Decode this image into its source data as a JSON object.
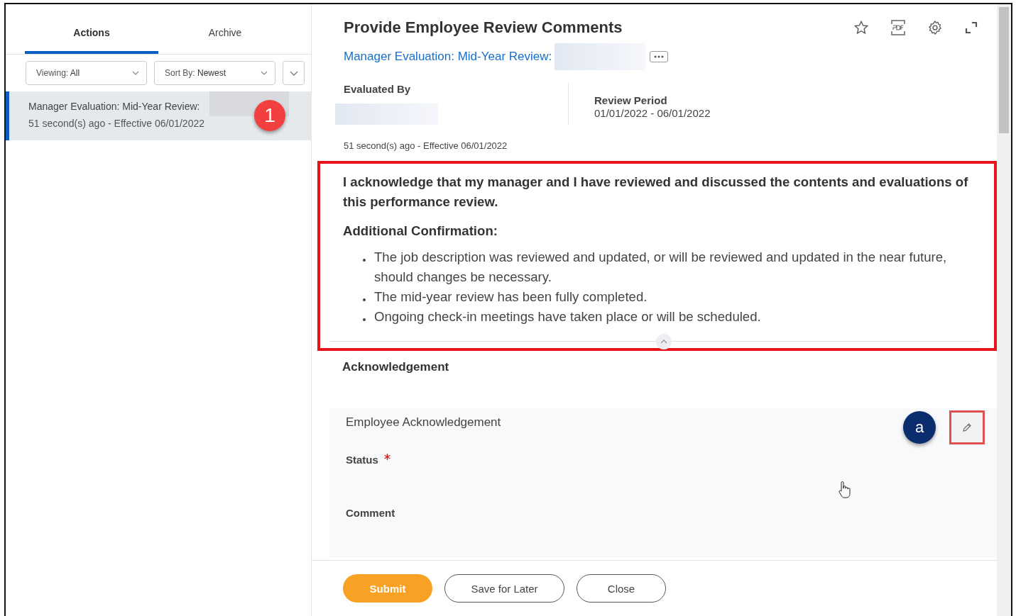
{
  "sidebar": {
    "tabs": [
      {
        "label": "Actions",
        "selected": true
      },
      {
        "label": "Archive",
        "selected": false
      }
    ],
    "filters": [
      {
        "label": "Viewing:",
        "value": "All"
      },
      {
        "label": "Sort By:",
        "value": "Newest"
      }
    ],
    "items": [
      {
        "title": "Manager Evaluation: Mid-Year Review:",
        "subtitle": "51 second(s) ago - Effective 06/01/2022",
        "selected": true,
        "callout": "1"
      }
    ]
  },
  "header": {
    "title": "Provide Employee Review Comments",
    "link": "Manager Evaluation: Mid-Year Review:",
    "evaluated_by": "Evaluated By",
    "review_period_label": "Review Period",
    "review_period": "01/01/2022 - 06/01/2022",
    "timestamp": "51 second(s) ago -  Effective 06/01/2022"
  },
  "notice": {
    "statement": "I acknowledge that my manager and I have reviewed and discussed the contents and evaluations of this performance review.",
    "heading": "Additional Confirmation:",
    "bullets": [
      "The job description was reviewed and updated, or will be reviewed and updated in the near future, should changes be necessary.",
      "The mid-year review has been fully completed.",
      "Ongoing check-in meetings have taken place or will be scheduled."
    ]
  },
  "acknowledgement": {
    "heading": "Acknowledgement",
    "card_title": "Employee Acknowledgement",
    "callout": "a",
    "fields": [
      {
        "label": "Status",
        "required": true
      },
      {
        "label": "Comment",
        "required": false
      }
    ]
  },
  "buttons": [
    {
      "label": "Submit",
      "kind": "primary"
    },
    {
      "label": "Save for Later",
      "kind": "secondary"
    },
    {
      "label": "Close",
      "kind": "secondary"
    }
  ]
}
